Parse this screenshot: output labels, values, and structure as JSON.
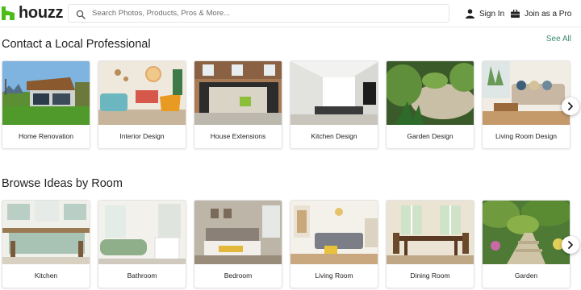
{
  "header": {
    "logo_text": "houzz",
    "search_placeholder": "Search Photos, Products, Pros & More...",
    "signin_label": "Sign In",
    "pro_label": "Join as a Pro"
  },
  "professionals": {
    "title": "Contact a Local Professional",
    "see_all": "See All",
    "cards": [
      {
        "label": "Home Renovation"
      },
      {
        "label": "Interior Design"
      },
      {
        "label": "House Extensions"
      },
      {
        "label": "Kitchen Design"
      },
      {
        "label": "Garden Design"
      },
      {
        "label": "Living Room Design"
      }
    ]
  },
  "rooms": {
    "title": "Browse Ideas by Room",
    "cards": [
      {
        "label": "Kitchen"
      },
      {
        "label": "Bathroom"
      },
      {
        "label": "Bedroom"
      },
      {
        "label": "Living Room"
      },
      {
        "label": "Dining Room"
      },
      {
        "label": "Garden"
      }
    ]
  },
  "colors": {
    "brand": "#4dbc15",
    "link": "#3a8a6b"
  },
  "icons": {
    "search": "search-icon",
    "user": "user-icon",
    "briefcase": "briefcase-icon",
    "next": "chevron-right-icon"
  }
}
